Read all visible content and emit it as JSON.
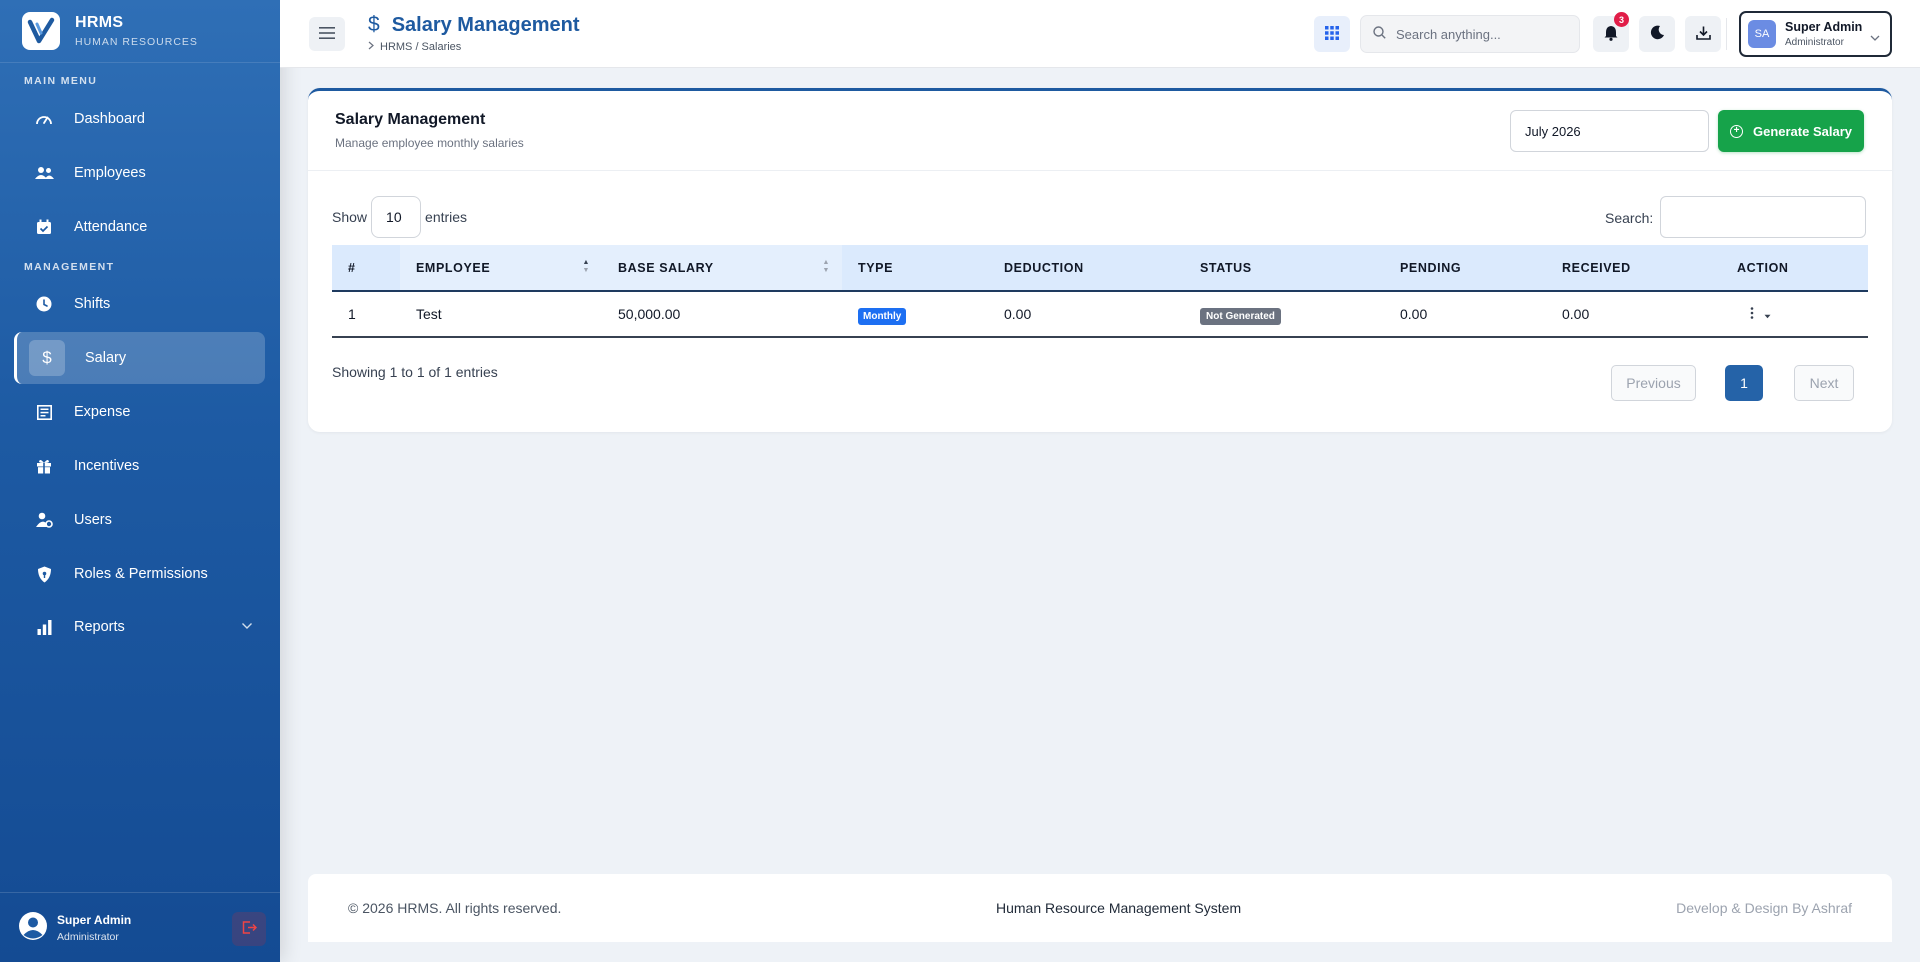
{
  "brand": {
    "title": "HRMS",
    "subtitle": "HUMAN RESOURCES"
  },
  "sidebar": {
    "main_menu_label": "MAIN MENU",
    "management_label": "MANAGEMENT",
    "items": [
      {
        "label": "Dashboard",
        "icon": "dashboard-gauge-icon"
      },
      {
        "label": "Employees",
        "icon": "users-icon"
      },
      {
        "label": "Attendance",
        "icon": "calendar-check-icon"
      },
      {
        "label": "Shifts",
        "icon": "clock-icon"
      },
      {
        "label": "Salary",
        "icon": "dollar-icon",
        "active": true
      },
      {
        "label": "Expense",
        "icon": "receipt-icon"
      },
      {
        "label": "Incentives",
        "icon": "gift-icon"
      },
      {
        "label": "Users",
        "icon": "user-gear-icon"
      },
      {
        "label": "Roles & Permissions",
        "icon": "shield-icon"
      },
      {
        "label": "Reports",
        "icon": "bar-chart-icon"
      }
    ],
    "footer": {
      "name": "Super Admin",
      "role": "Administrator"
    }
  },
  "header": {
    "title": "Salary Management",
    "title_symbol": "$",
    "breadcrumb": "HRMS / Salaries",
    "search_placeholder": "Search anything...",
    "notification_count": "3",
    "user": {
      "initials": "SA",
      "name": "Super Admin",
      "role": "Administrator"
    }
  },
  "card": {
    "title": "Salary Management",
    "subtitle": "Manage employee monthly salaries",
    "month_value": "July 2026",
    "generate_label": "Generate Salary",
    "show_label": "Show",
    "entries_value": "10",
    "entries_label": "entries",
    "search_label": "Search:"
  },
  "table": {
    "columns": [
      "#",
      "EMPLOYEE",
      "BASE SALARY",
      "TYPE",
      "DEDUCTION",
      "STATUS",
      "PENDING",
      "RECEIVED",
      "ACTION"
    ],
    "rows": [
      {
        "num": "1",
        "employee": "Test",
        "base_salary": "50,000.00",
        "type": "Monthly",
        "deduction": "0.00",
        "status": "Not Generated",
        "pending": "0.00",
        "received": "0.00"
      }
    ],
    "showing_text": "Showing 1 to 1 of 1 entries",
    "pager": {
      "previous": "Previous",
      "page": "1",
      "next": "Next"
    }
  },
  "footer": {
    "copyright": "© 2026 HRMS. All rights reserved.",
    "center": "Human Resource Management System",
    "credit": "Develop & Design By Ashraf"
  },
  "colors": {
    "sidebar_top": "#2f6fb6",
    "sidebar_bottom": "#144b93",
    "accent": "#1e5aa0",
    "success": "#16a34a",
    "badge_blue": "#1d6ff2",
    "badge_gray": "#6b7280",
    "notif_red": "#e11d48"
  }
}
